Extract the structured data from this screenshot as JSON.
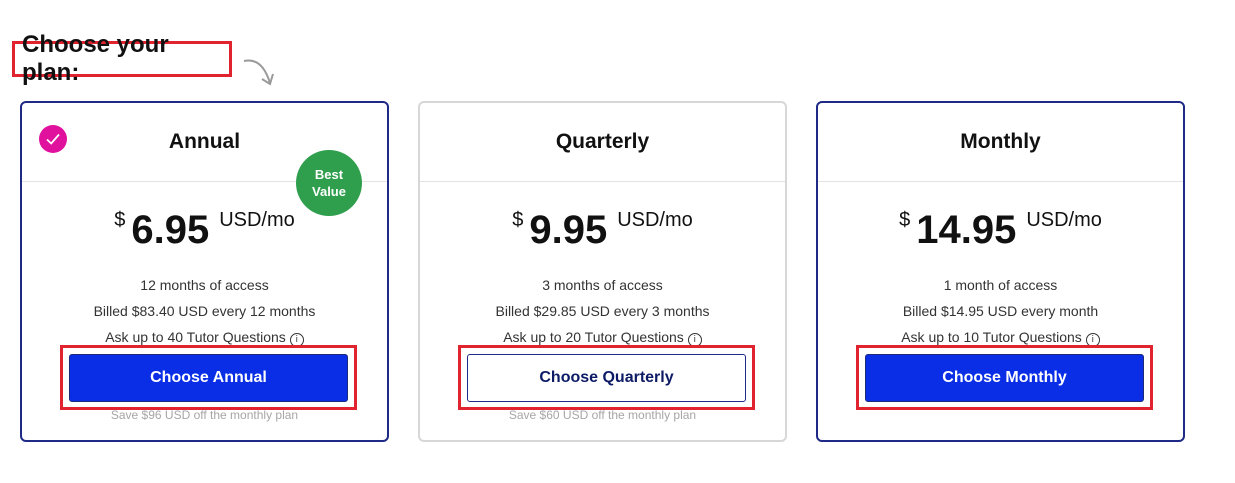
{
  "heading": "Choose your plan:",
  "plans": [
    {
      "name": "Annual",
      "selected": true,
      "badge": {
        "line1": "Best",
        "line2": "Value"
      },
      "currency": "$",
      "price": "6.95",
      "unit": "USD/mo",
      "details": [
        "12 months of access",
        "Billed $83.40 USD every 12 months",
        "Ask up to 40 Tutor Questions"
      ],
      "button_label": "Choose Annual",
      "savings": "Save $96 USD off the monthly plan"
    },
    {
      "name": "Quarterly",
      "selected": false,
      "currency": "$",
      "price": "9.95",
      "unit": "USD/mo",
      "details": [
        "3 months of access",
        "Billed $29.85 USD every 3 months",
        "Ask up to 20 Tutor Questions"
      ],
      "button_label": "Choose Quarterly",
      "savings": "Save $60 USD off the monthly plan"
    },
    {
      "name": "Monthly",
      "selected": false,
      "currency": "$",
      "price": "14.95",
      "unit": "USD/mo",
      "details": [
        "1 month of access",
        "Billed $14.95 USD every month",
        "Ask up to 10 Tutor Questions"
      ],
      "button_label": "Choose Monthly",
      "savings": ""
    }
  ],
  "icons": {
    "info": "info-circle-icon",
    "check": "checkmark-icon",
    "arrow": "curved-arrow-icon"
  },
  "colors": {
    "accent": "#0a2de6",
    "selected_border": "#1f2a86",
    "check": "#e0119c",
    "badge": "#2f9e4d",
    "highlight": "#e0232e"
  }
}
